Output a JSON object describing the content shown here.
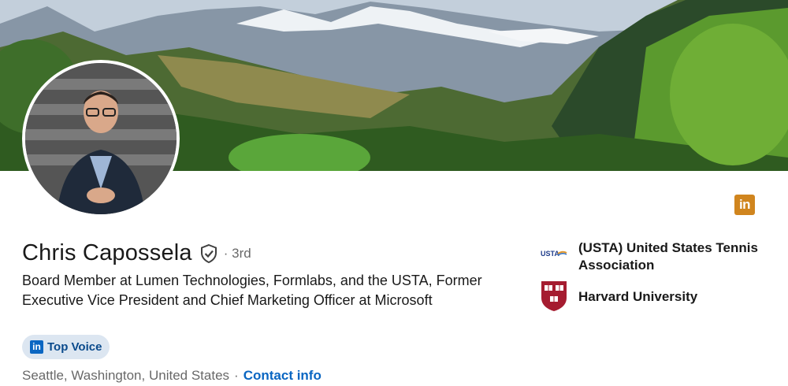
{
  "profile": {
    "name": "Chris Capossela",
    "degree": "· 3rd",
    "headline": "Board Member at Lumen Technologies, Formlabs, and the USTA, Former Executive Vice President and Chief Marketing Officer at Microsoft",
    "badge": "Top Voice",
    "location": "Seattle, Washington, United States",
    "separator": "·",
    "contact_info": "Contact info"
  },
  "organizations": [
    {
      "name": "(USTA) United States Tennis Association",
      "logo_text": "USTA",
      "icon": "usta-logo"
    },
    {
      "name": "Harvard University",
      "icon": "harvard-shield-icon"
    }
  ],
  "icons": {
    "linkedin": "in",
    "verified": "verified-shield-icon"
  },
  "colors": {
    "link": "#0a66c2",
    "badge_bg": "#dce6f1",
    "linkedin_orange": "#d0851e",
    "harvard_crimson": "#a51c30"
  }
}
